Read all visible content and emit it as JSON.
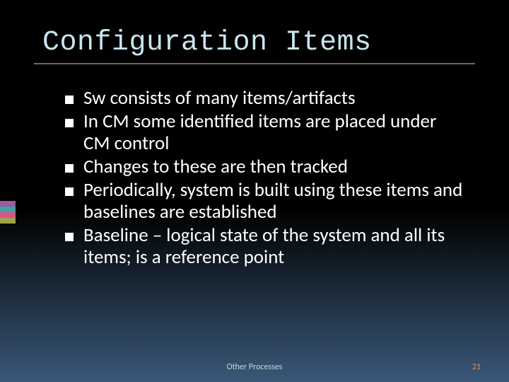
{
  "title": "Configuration Items",
  "bullets": [
    "Sw consists of many items/artifacts",
    "In CM some identified items are placed under CM control",
    "Changes to these are then tracked",
    "Periodically, system is built using these items and baselines are established",
    "Baseline – logical state of the system and all its items; is a reference point"
  ],
  "footer": {
    "center": "Other Processes",
    "page_number": "21"
  },
  "accent_colors": [
    "#9b5ba5",
    "#3fa39e",
    "#d9548a",
    "#9fa34a"
  ]
}
